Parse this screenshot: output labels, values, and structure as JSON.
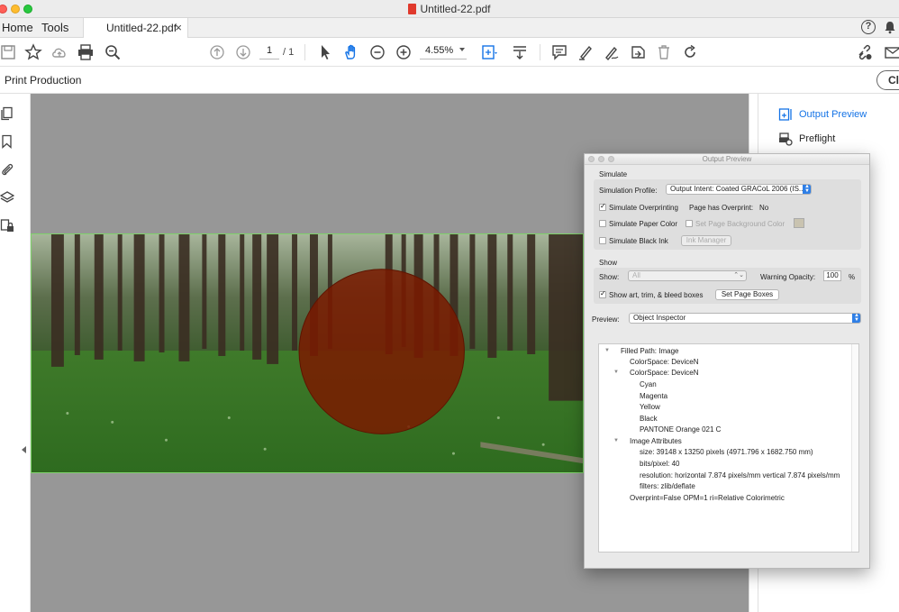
{
  "window": {
    "title": "Untitled-22.pdf"
  },
  "tabs": {
    "home": "Home",
    "tools": "Tools",
    "document": "Untitled-22.pdf",
    "close": "×"
  },
  "toolbar": {
    "page_current": "1",
    "page_total": "/ 1",
    "zoom": "4.55%"
  },
  "production": {
    "title": "Print Production",
    "close_label": "Clo"
  },
  "right_panel": {
    "output_preview": "Output Preview",
    "preflight": "Preflight"
  },
  "dialog": {
    "title": "Output Preview",
    "simulate": {
      "heading": "Simulate",
      "profile_label": "Simulation Profile:",
      "profile_value": "Output Intent: Coated GRACoL 2006 (IS...",
      "simulate_overprinting": "Simulate Overprinting",
      "simulate_overprinting_checked": true,
      "page_has_overprint_label": "Page has Overprint:",
      "page_has_overprint_value": "No",
      "simulate_paper_color": "Simulate Paper Color",
      "set_page_bg": "Set Page Background Color",
      "simulate_black_ink": "Simulate Black Ink",
      "ink_manager": "Ink Manager"
    },
    "show": {
      "heading": "Show",
      "show_label": "Show:",
      "show_value": "All",
      "warning_opacity_label": "Warning Opacity:",
      "warning_opacity_value": "100",
      "percent": "%",
      "show_boxes": "Show art, trim, & bleed boxes",
      "show_boxes_checked": true,
      "set_page_boxes": "Set Page Boxes"
    },
    "preview": {
      "label": "Preview:",
      "value": "Object Inspector"
    },
    "inspector": {
      "filled_path": "Filled Path: Image",
      "colorspace1": "ColorSpace: DeviceN",
      "colorspace2": "ColorSpace: DeviceN",
      "cyan": "Cyan",
      "magenta": "Magenta",
      "yellow": "Yellow",
      "black": "Black",
      "pantone": "PANTONE Orange 021 C",
      "image_attributes": "Image Attributes",
      "size": "size: 39148 x 13250 pixels (4971.796 x 1682.750 mm)",
      "bits": "bits/pixel: 40",
      "resolution": "resolution: horizontal 7.874 pixels/mm vertical 7.874 pixels/mm",
      "filters": "filters: zlib/deflate",
      "overprint": "Overprint=False OPM=1 ri=Relative Colorimetric"
    }
  },
  "colors": {
    "accent": "#1473e6",
    "highlight_circle": "#7a1a00",
    "canvas": "#979797"
  }
}
